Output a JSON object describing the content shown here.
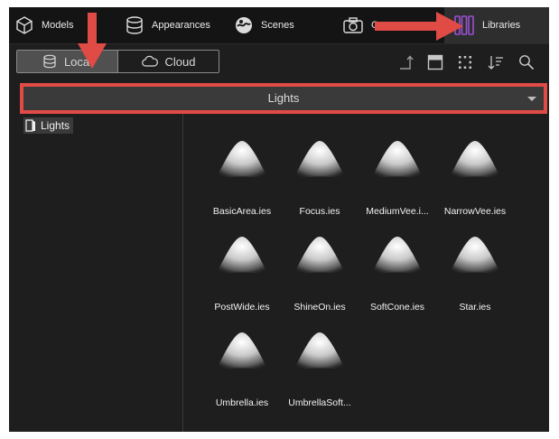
{
  "tabs": [
    {
      "label": "Models",
      "icon": "cube-icon"
    },
    {
      "label": "Appearances",
      "icon": "cylinder-icon"
    },
    {
      "label": "Scenes",
      "icon": "globe-icon"
    },
    {
      "label": "Ca",
      "icon": "camera-icon"
    },
    {
      "label": "Libraries",
      "icon": "books-icon",
      "active": true
    }
  ],
  "source_toggle": {
    "local_label": "Local",
    "cloud_label": "Cloud",
    "selected": "Local"
  },
  "toolbar_icons": [
    "upload-icon",
    "view-toggle-icon",
    "grid-view-icon",
    "sort-icon",
    "search-icon"
  ],
  "dropdown": {
    "value": "Lights"
  },
  "tree": {
    "items": [
      {
        "label": "Lights",
        "icon": "folder-icon"
      }
    ]
  },
  "files": [
    {
      "name": "BasicArea.ies"
    },
    {
      "name": "Focus.ies"
    },
    {
      "name": "MediumVee.i..."
    },
    {
      "name": "NarrowVee.ies"
    },
    {
      "name": "PostWide.ies"
    },
    {
      "name": "ShineOn.ies"
    },
    {
      "name": "SoftCone.ies"
    },
    {
      "name": "Star.ies"
    },
    {
      "name": "Umbrella.ies"
    },
    {
      "name": "UmbrellaSoft..."
    }
  ],
  "colors": {
    "annotation": "#e04b45",
    "active_tab_icon": "#9c4fd4"
  }
}
